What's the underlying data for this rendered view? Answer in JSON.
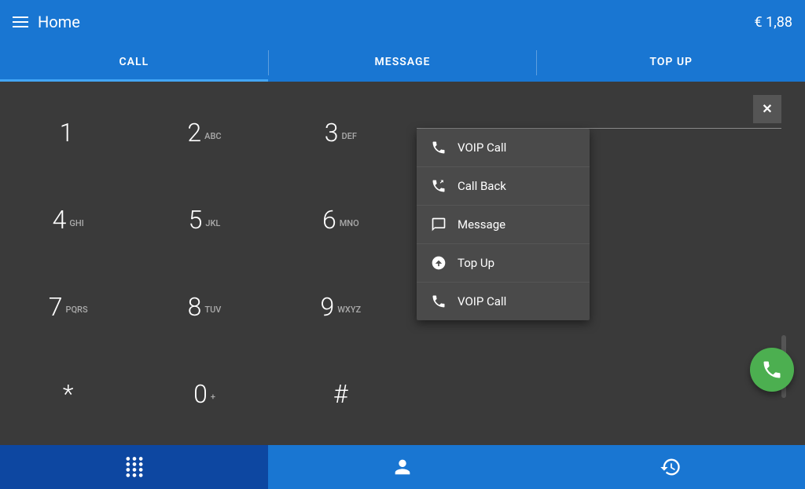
{
  "header": {
    "title": "Home",
    "balance": "€ 1,88",
    "menu_icon": "menu-icon"
  },
  "tabs": [
    {
      "label": "CALL",
      "active": true
    },
    {
      "label": "MESSAGE",
      "active": false
    },
    {
      "label": "TOP UP",
      "active": false
    }
  ],
  "dialpad": {
    "keys": [
      {
        "digit": "1",
        "sub": ""
      },
      {
        "digit": "2",
        "sub": "ABC"
      },
      {
        "digit": "3",
        "sub": "DEF"
      },
      {
        "digit": "4",
        "sub": "GHI"
      },
      {
        "digit": "5",
        "sub": "JKL"
      },
      {
        "digit": "6",
        "sub": "MNO"
      },
      {
        "digit": "7",
        "sub": "PQRS"
      },
      {
        "digit": "8",
        "sub": "TUV"
      },
      {
        "digit": "9",
        "sub": "WXYZ"
      },
      {
        "digit": "*",
        "sub": ""
      },
      {
        "digit": "0",
        "sub": "+"
      },
      {
        "digit": "#",
        "sub": ""
      }
    ]
  },
  "input": {
    "placeholder": "",
    "value": "",
    "clear_label": "✕"
  },
  "dropdown": {
    "items": [
      {
        "id": "voip-call-1",
        "label": "VOIP Call",
        "icon": "phone"
      },
      {
        "id": "call-back",
        "label": "Call Back",
        "icon": "callback"
      },
      {
        "id": "message",
        "label": "Message",
        "icon": "message"
      },
      {
        "id": "top-up",
        "label": "Top Up",
        "icon": "topup"
      },
      {
        "id": "voip-call-2",
        "label": "VOIP Call",
        "icon": "phone"
      }
    ]
  },
  "bottom_nav": [
    {
      "id": "dialpad-nav",
      "icon": "dialpad",
      "active": true
    },
    {
      "id": "contacts-nav",
      "icon": "person",
      "active": false
    },
    {
      "id": "history-nav",
      "icon": "history",
      "active": false
    }
  ],
  "fab": {
    "icon": "phone-call",
    "color": "#4caf50"
  }
}
